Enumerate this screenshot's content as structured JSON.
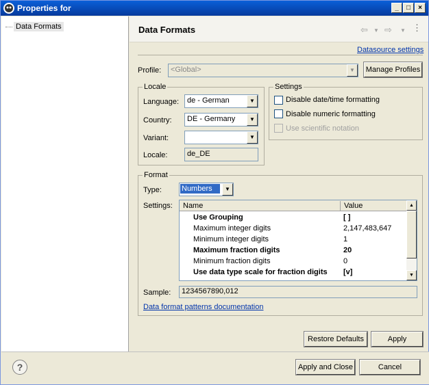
{
  "window": {
    "title": "Properties for"
  },
  "tree": {
    "items": [
      {
        "label": "Data Formats"
      }
    ]
  },
  "header": {
    "title": "Data Formats"
  },
  "links": {
    "datasource_settings": "Datasource settings",
    "patterns_doc": "Data format patterns documentation"
  },
  "profile": {
    "label": "Profile:",
    "value": "<Global>",
    "manage_label": "Manage Profiles"
  },
  "locale": {
    "group_title": "Locale",
    "language_label": "Language:",
    "language_value": "de - German",
    "country_label": "Country:",
    "country_value": "DE - Germany",
    "variant_label": "Variant:",
    "variant_value": "",
    "locale_label": "Locale:",
    "locale_value": "de_DE"
  },
  "settings": {
    "group_title": "Settings",
    "disable_datetime": "Disable date/time formatting",
    "disable_numeric": "Disable numeric formatting",
    "scientific": "Use scientific notation"
  },
  "format": {
    "group_title": "Format",
    "type_label": "Type:",
    "type_value": "Numbers",
    "settings_label": "Settings:",
    "columns": [
      "Name",
      "Value"
    ],
    "rows": [
      {
        "name": "Use Grouping",
        "value": "[ ]",
        "bold": true
      },
      {
        "name": "Maximum integer digits",
        "value": "2,147,483,647",
        "bold": false
      },
      {
        "name": "Minimum integer digits",
        "value": "1",
        "bold": false
      },
      {
        "name": "Maximum fraction digits",
        "value": "20",
        "bold": true
      },
      {
        "name": "Minimum fraction digits",
        "value": "0",
        "bold": false
      },
      {
        "name": "Use data type scale for fraction digits",
        "value": "[v]",
        "bold": true
      }
    ],
    "sample_label": "Sample:",
    "sample_value": "1234567890,012"
  },
  "buttons": {
    "restore_defaults": "Restore Defaults",
    "apply": "Apply",
    "apply_close": "Apply and Close",
    "cancel": "Cancel"
  },
  "icons": {
    "help": "?"
  }
}
